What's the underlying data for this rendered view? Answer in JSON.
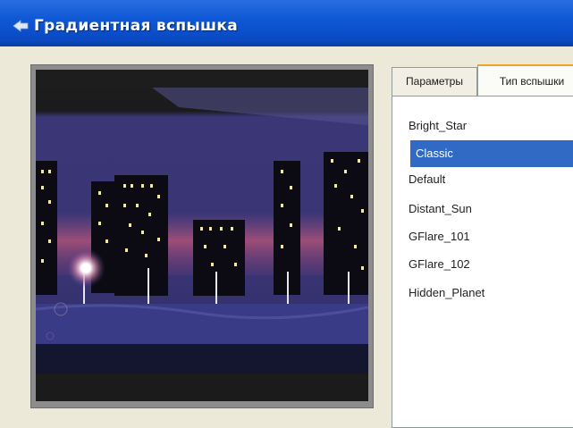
{
  "window": {
    "title": "Градиентная вспышка"
  },
  "tabs": [
    {
      "label": "Параметры"
    },
    {
      "label": "Тип вспышки"
    }
  ],
  "flare_list": {
    "selected": "Classic",
    "items": [
      "Bright_Star",
      "Classic",
      "Default",
      "Distant_Sun",
      "GFlare_101",
      "GFlare_102",
      "Hidden_Planet"
    ]
  },
  "colors": {
    "titlebar": "#0f58d6",
    "selection": "#316ac5",
    "night_sky": "#3a3575",
    "glow": "#d45a78"
  }
}
